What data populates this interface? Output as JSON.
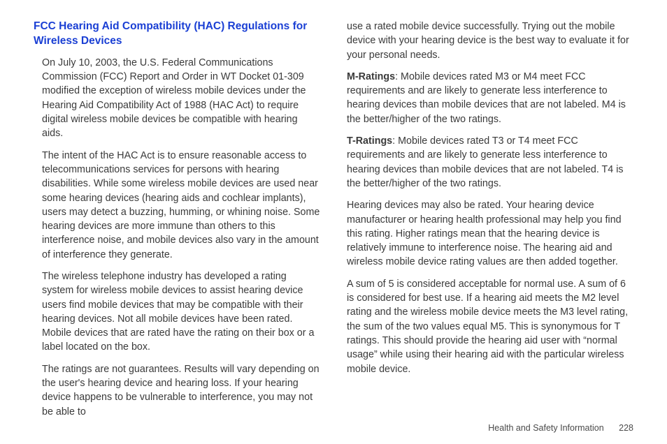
{
  "heading": "FCC Hearing Aid Compatibility (HAC) Regulations for Wireless Devices",
  "col1": {
    "p1": "On July 10, 2003, the U.S. Federal Communications Commission (FCC) Report and Order in WT Docket 01-309 modified the exception of wireless mobile devices under the Hearing Aid Compatibility Act of 1988 (HAC Act) to require digital wireless mobile devices be compatible with hearing aids.",
    "p2": "The intent of the HAC Act is to ensure reasonable access to telecommunications services for persons with hearing disabilities. While some wireless mobile devices are used near some hearing devices (hearing aids and cochlear implants), users may detect a buzzing, humming, or whining noise. Some hearing devices are more immune than others to this interference noise, and mobile devices also vary in the amount of interference they generate.",
    "p3": "The wireless telephone industry has developed a rating system for wireless mobile devices to assist hearing device users find mobile devices that may be compatible with their hearing devices. Not all mobile devices have been rated. Mobile devices that are rated have the rating on their box or a label located on the box.",
    "p4": "The ratings are not guarantees. Results will vary depending on the user's hearing device and hearing loss. If your hearing device happens to be vulnerable to interference, you may not be able to"
  },
  "col2": {
    "p1": "use a rated mobile device successfully. Trying out the mobile device with your hearing device is the best way to evaluate it for your personal needs.",
    "p2_label": "M-Ratings",
    "p2": ": Mobile devices rated M3 or M4 meet FCC requirements and are likely to generate less interference to hearing devices than mobile devices that are not labeled. M4 is the better/higher of the two ratings.",
    "p3_label": "T-Ratings",
    "p3": ": Mobile devices rated T3 or T4 meet FCC requirements and are likely to generate less interference to hearing devices than mobile devices that are not labeled. T4 is the better/higher of the two ratings.",
    "p4": "Hearing devices may also be rated. Your hearing device manufacturer or hearing health professional may help you find this rating. Higher ratings mean that the hearing device is relatively immune to interference noise. The hearing aid and wireless mobile device rating values are then added together.",
    "p5": "A sum of 5 is considered acceptable for normal use. A sum of 6 is considered for best use. If a hearing aid meets the M2 level rating and the wireless mobile device meets the M3 level rating, the sum of the two values equal M5. This is synonymous for T ratings. This should provide the hearing aid user with “normal usage” while using their hearing aid with the particular wireless mobile device."
  },
  "footer": {
    "section": "Health and Safety Information",
    "page": "228"
  }
}
